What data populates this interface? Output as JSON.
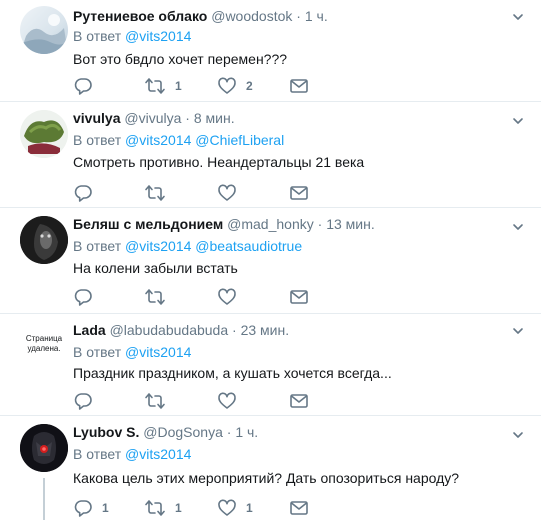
{
  "reply_prefix": "В ответ",
  "tweets": [
    {
      "name": "Рутениевое облако",
      "handle": "@woodostok",
      "time": "1 ч.",
      "mentions": [
        "@vits2014"
      ],
      "text": "Вот это бвдло хочет перемен???",
      "counts": {
        "reply": "",
        "retweet": "1",
        "like": "2"
      }
    },
    {
      "name": "vivulya",
      "handle": "@vivulya",
      "time": "8 мин.",
      "mentions": [
        "@vits2014",
        "@ChiefLiberal"
      ],
      "text": "Смотреть противно. Неандертальцы 21 века",
      "counts": {
        "reply": "",
        "retweet": "",
        "like": ""
      }
    },
    {
      "name": "Беляш с мельдонием",
      "handle": "@mad_honky",
      "time": "13 мин.",
      "mentions": [
        "@vits2014",
        "@beatsaudiotrue"
      ],
      "text": "На колени забыли встать",
      "counts": {
        "reply": "",
        "retweet": "",
        "like": ""
      }
    },
    {
      "name": "Lada",
      "handle": "@labudabudabuda",
      "time": "23 мин.",
      "mentions": [
        "@vits2014"
      ],
      "text": "Праздник праздником, а кушать хочется всегда...",
      "avatar_text": [
        "Страница",
        "удалена."
      ],
      "counts": {
        "reply": "",
        "retweet": "",
        "like": ""
      }
    },
    {
      "name": "Lyubov S.",
      "handle": "@DogSonya",
      "time": "1 ч.",
      "mentions": [
        "@vits2014"
      ],
      "text": "Какова цель этих мероприятий? Дать опозориться народу?",
      "counts": {
        "reply": "1",
        "retweet": "1",
        "like": "1"
      }
    }
  ],
  "colors": {
    "accent": "#1da1f2",
    "muted": "#657786",
    "separator": "#e6ecf0",
    "thread_line": "#c4cfd6"
  }
}
